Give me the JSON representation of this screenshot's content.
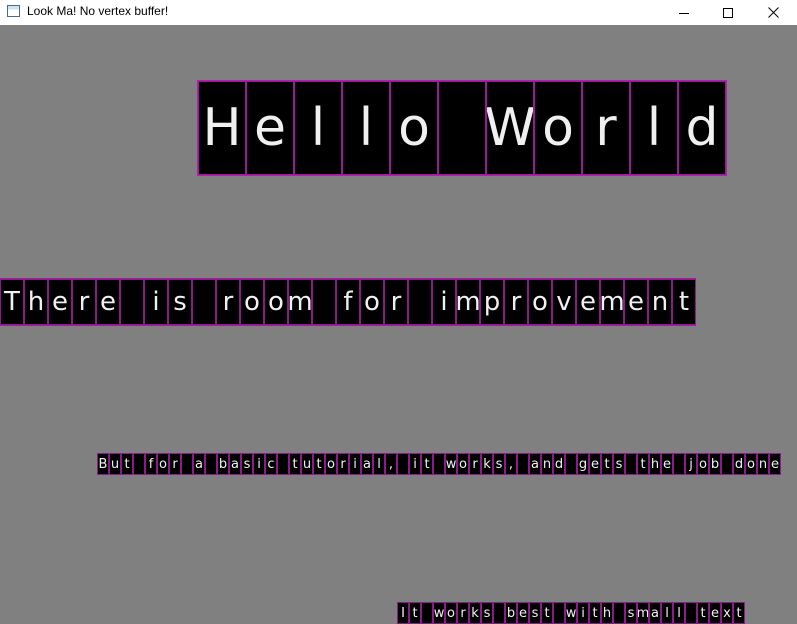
{
  "window": {
    "title": "Look Ma! No vertex buffer!",
    "minimize_icon": "minimize-icon",
    "maximize_icon": "maximize-icon",
    "close_icon": "close-icon"
  },
  "colors": {
    "canvas_background": "#808080",
    "glyph_background": "#000000",
    "glyph_border": "#8a1c8a",
    "glyph_text": "#f0f0f0"
  },
  "text_lines": [
    "Hello World",
    "There is room for improvement",
    "But for a basic tutorial, it works, and gets the job done",
    "It works best with small text"
  ]
}
